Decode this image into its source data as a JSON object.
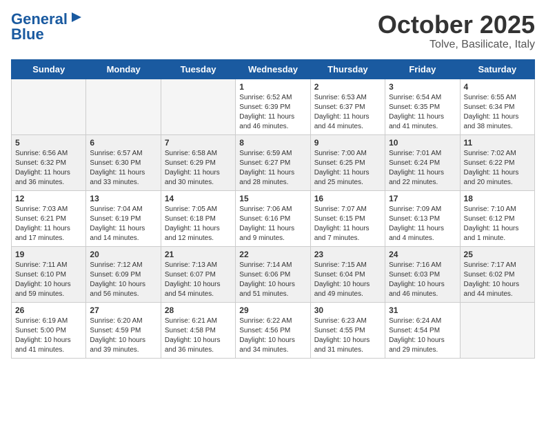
{
  "header": {
    "logo_general": "General",
    "logo_blue": "Blue",
    "month": "October 2025",
    "location": "Tolve, Basilicate, Italy"
  },
  "days_of_week": [
    "Sunday",
    "Monday",
    "Tuesday",
    "Wednesday",
    "Thursday",
    "Friday",
    "Saturday"
  ],
  "weeks": [
    [
      {
        "day": "",
        "info": ""
      },
      {
        "day": "",
        "info": ""
      },
      {
        "day": "",
        "info": ""
      },
      {
        "day": "1",
        "info": "Sunrise: 6:52 AM\nSunset: 6:39 PM\nDaylight: 11 hours and 46 minutes."
      },
      {
        "day": "2",
        "info": "Sunrise: 6:53 AM\nSunset: 6:37 PM\nDaylight: 11 hours and 44 minutes."
      },
      {
        "day": "3",
        "info": "Sunrise: 6:54 AM\nSunset: 6:35 PM\nDaylight: 11 hours and 41 minutes."
      },
      {
        "day": "4",
        "info": "Sunrise: 6:55 AM\nSunset: 6:34 PM\nDaylight: 11 hours and 38 minutes."
      }
    ],
    [
      {
        "day": "5",
        "info": "Sunrise: 6:56 AM\nSunset: 6:32 PM\nDaylight: 11 hours and 36 minutes."
      },
      {
        "day": "6",
        "info": "Sunrise: 6:57 AM\nSunset: 6:30 PM\nDaylight: 11 hours and 33 minutes."
      },
      {
        "day": "7",
        "info": "Sunrise: 6:58 AM\nSunset: 6:29 PM\nDaylight: 11 hours and 30 minutes."
      },
      {
        "day": "8",
        "info": "Sunrise: 6:59 AM\nSunset: 6:27 PM\nDaylight: 11 hours and 28 minutes."
      },
      {
        "day": "9",
        "info": "Sunrise: 7:00 AM\nSunset: 6:25 PM\nDaylight: 11 hours and 25 minutes."
      },
      {
        "day": "10",
        "info": "Sunrise: 7:01 AM\nSunset: 6:24 PM\nDaylight: 11 hours and 22 minutes."
      },
      {
        "day": "11",
        "info": "Sunrise: 7:02 AM\nSunset: 6:22 PM\nDaylight: 11 hours and 20 minutes."
      }
    ],
    [
      {
        "day": "12",
        "info": "Sunrise: 7:03 AM\nSunset: 6:21 PM\nDaylight: 11 hours and 17 minutes."
      },
      {
        "day": "13",
        "info": "Sunrise: 7:04 AM\nSunset: 6:19 PM\nDaylight: 11 hours and 14 minutes."
      },
      {
        "day": "14",
        "info": "Sunrise: 7:05 AM\nSunset: 6:18 PM\nDaylight: 11 hours and 12 minutes."
      },
      {
        "day": "15",
        "info": "Sunrise: 7:06 AM\nSunset: 6:16 PM\nDaylight: 11 hours and 9 minutes."
      },
      {
        "day": "16",
        "info": "Sunrise: 7:07 AM\nSunset: 6:15 PM\nDaylight: 11 hours and 7 minutes."
      },
      {
        "day": "17",
        "info": "Sunrise: 7:09 AM\nSunset: 6:13 PM\nDaylight: 11 hours and 4 minutes."
      },
      {
        "day": "18",
        "info": "Sunrise: 7:10 AM\nSunset: 6:12 PM\nDaylight: 11 hours and 1 minute."
      }
    ],
    [
      {
        "day": "19",
        "info": "Sunrise: 7:11 AM\nSunset: 6:10 PM\nDaylight: 10 hours and 59 minutes."
      },
      {
        "day": "20",
        "info": "Sunrise: 7:12 AM\nSunset: 6:09 PM\nDaylight: 10 hours and 56 minutes."
      },
      {
        "day": "21",
        "info": "Sunrise: 7:13 AM\nSunset: 6:07 PM\nDaylight: 10 hours and 54 minutes."
      },
      {
        "day": "22",
        "info": "Sunrise: 7:14 AM\nSunset: 6:06 PM\nDaylight: 10 hours and 51 minutes."
      },
      {
        "day": "23",
        "info": "Sunrise: 7:15 AM\nSunset: 6:04 PM\nDaylight: 10 hours and 49 minutes."
      },
      {
        "day": "24",
        "info": "Sunrise: 7:16 AM\nSunset: 6:03 PM\nDaylight: 10 hours and 46 minutes."
      },
      {
        "day": "25",
        "info": "Sunrise: 7:17 AM\nSunset: 6:02 PM\nDaylight: 10 hours and 44 minutes."
      }
    ],
    [
      {
        "day": "26",
        "info": "Sunrise: 6:19 AM\nSunset: 5:00 PM\nDaylight: 10 hours and 41 minutes."
      },
      {
        "day": "27",
        "info": "Sunrise: 6:20 AM\nSunset: 4:59 PM\nDaylight: 10 hours and 39 minutes."
      },
      {
        "day": "28",
        "info": "Sunrise: 6:21 AM\nSunset: 4:58 PM\nDaylight: 10 hours and 36 minutes."
      },
      {
        "day": "29",
        "info": "Sunrise: 6:22 AM\nSunset: 4:56 PM\nDaylight: 10 hours and 34 minutes."
      },
      {
        "day": "30",
        "info": "Sunrise: 6:23 AM\nSunset: 4:55 PM\nDaylight: 10 hours and 31 minutes."
      },
      {
        "day": "31",
        "info": "Sunrise: 6:24 AM\nSunset: 4:54 PM\nDaylight: 10 hours and 29 minutes."
      },
      {
        "day": "",
        "info": ""
      }
    ]
  ]
}
